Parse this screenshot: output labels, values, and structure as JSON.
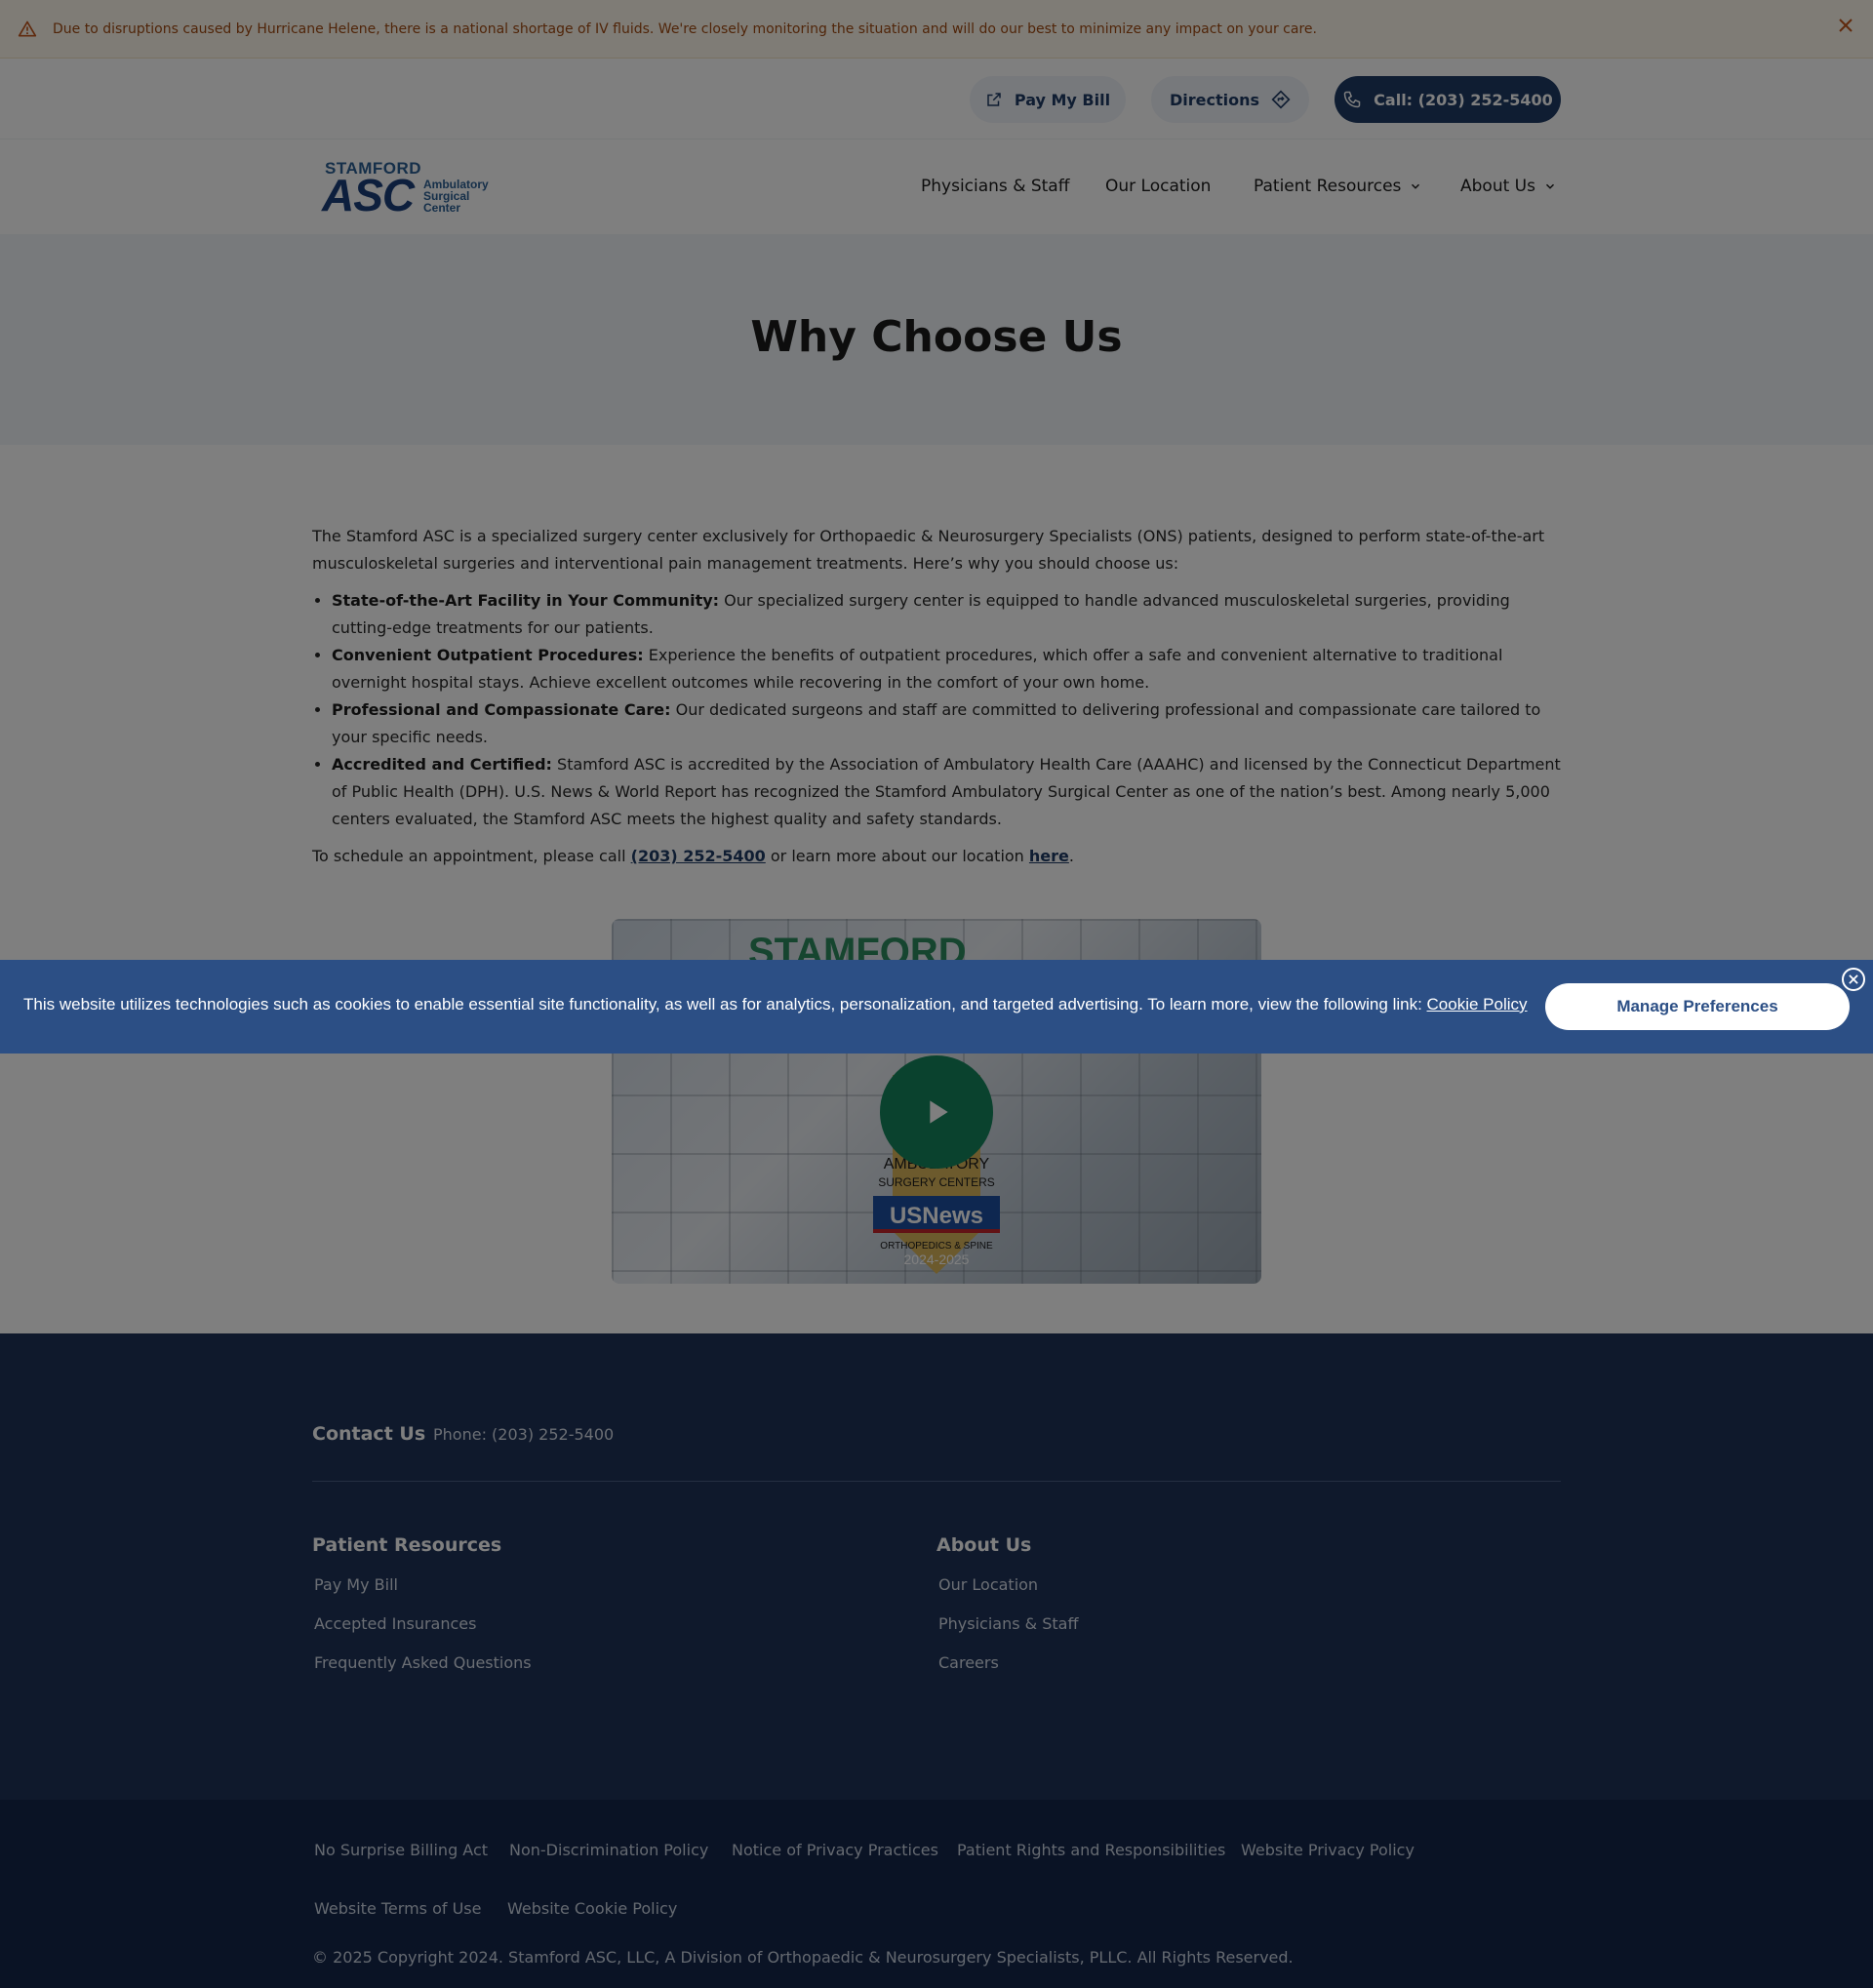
{
  "alert": {
    "text": "Due to disruptions caused by Hurricane Helene, there is a national shortage of IV fluids. We're closely monitoring the situation and will do our best to minimize any impact on your care.",
    "icon": "warning-triangle-icon",
    "close_icon": "close-icon"
  },
  "utility": {
    "pay_bill": "Pay My Bill",
    "directions": "Directions",
    "call": "Call: (203) 252-5400"
  },
  "logo": {
    "line1": "STAMFORD",
    "line2": "ASC",
    "sub1": "Ambulatory",
    "sub2": "Surgical",
    "sub3": "Center"
  },
  "nav": {
    "items": [
      {
        "label": "Physicians & Staff"
      },
      {
        "label": "Our Location"
      },
      {
        "label": "Patient Resources"
      },
      {
        "label": "About Us"
      }
    ]
  },
  "hero": {
    "title": "Why Choose Us"
  },
  "content": {
    "intro": "The Stamford ASC is a specialized surgery center exclusively for Orthopaedic & Neurosurgery Specialists (ONS) patients, designed to perform state-of-the-art musculoskeletal surgeries and interventional pain management treatments. Here’s why you should choose us:",
    "bullets": [
      {
        "title": "State-of-the-Art Facility in Your Community:",
        "text": " Our specialized surgery center is equipped to handle advanced musculoskeletal surgeries, providing cutting-edge treatments for our patients."
      },
      {
        "title": "Convenient Outpatient Procedures:",
        "text": " Experience the benefits of outpatient procedures, which offer a safe and convenient alternative to traditional overnight hospital stays. Achieve excellent outcomes while recovering in the comfort of your own home."
      },
      {
        "title": "Professional and Compassionate Care:",
        "text": " Our dedicated surgeons and staff are committed to delivering professional and compassionate care tailored to your specific needs."
      },
      {
        "title": "Accredited and Certified:",
        "text": " Stamford ASC is accredited by the Association of Ambulatory Health Care (AAAHC) and licensed by the Connecticut Department of Public Health (DPH). U.S. News & World Report has recognized the Stamford Ambulatory Surgical Center as one of the nation’s best. Among nearly 5,000 centers evaluated, the Stamford ASC meets the highest quality and safety standards."
      }
    ],
    "schedule_pre": "To schedule an appointment, please call ",
    "schedule_phone": "(203) 252-5400",
    "schedule_mid": " or learn more about our location ",
    "schedule_link": "here",
    "schedule_end": "."
  },
  "video": {
    "title_text": "STAMFORD",
    "badge_line1": "AMBULATORY",
    "badge_line2": "SURGERY CENTERS",
    "badge_brand": "USNews",
    "badge_line3": "ORTHOPEDICS & SPINE",
    "badge_years": "2024-2025"
  },
  "cookie": {
    "text": "This website utilizes technologies such as cookies to enable essential site functionality, as well as for analytics, personalization, and targeted advertising. To learn more, view the following link: ",
    "link": "Cookie Policy",
    "manage": "Manage Preferences"
  },
  "footer": {
    "contact_heading": "Contact Us",
    "phone": "Phone: (203) 252-5400",
    "patient_resources": {
      "heading": "Patient Resources",
      "links": [
        "Pay My Bill",
        "Accepted Insurances",
        "Frequently Asked Questions"
      ]
    },
    "about_us": {
      "heading": "About Us",
      "links": [
        "Our Location",
        "Physicians & Staff",
        "Careers"
      ]
    },
    "bottom_links": [
      "No Surprise Billing Act",
      "Non-Discrimination Policy",
      "Notice of Privacy Practices",
      "Patient Rights and Responsibilities",
      "Website Privacy Policy",
      "Website Terms of Use",
      "Website Cookie Policy"
    ],
    "copyright": "© 2025 Copyright 2024. Stamford ASC, LLC, A Division of Orthopaedic & Neurosurgery Specialists, PLLC. All Rights Reserved."
  },
  "colors": {
    "navy": "#1e3a64",
    "footer_bg": "#1e3358",
    "cookie_bg": "#2c4f85",
    "alert_text": "#a04a12",
    "play_green": "#14855c"
  }
}
